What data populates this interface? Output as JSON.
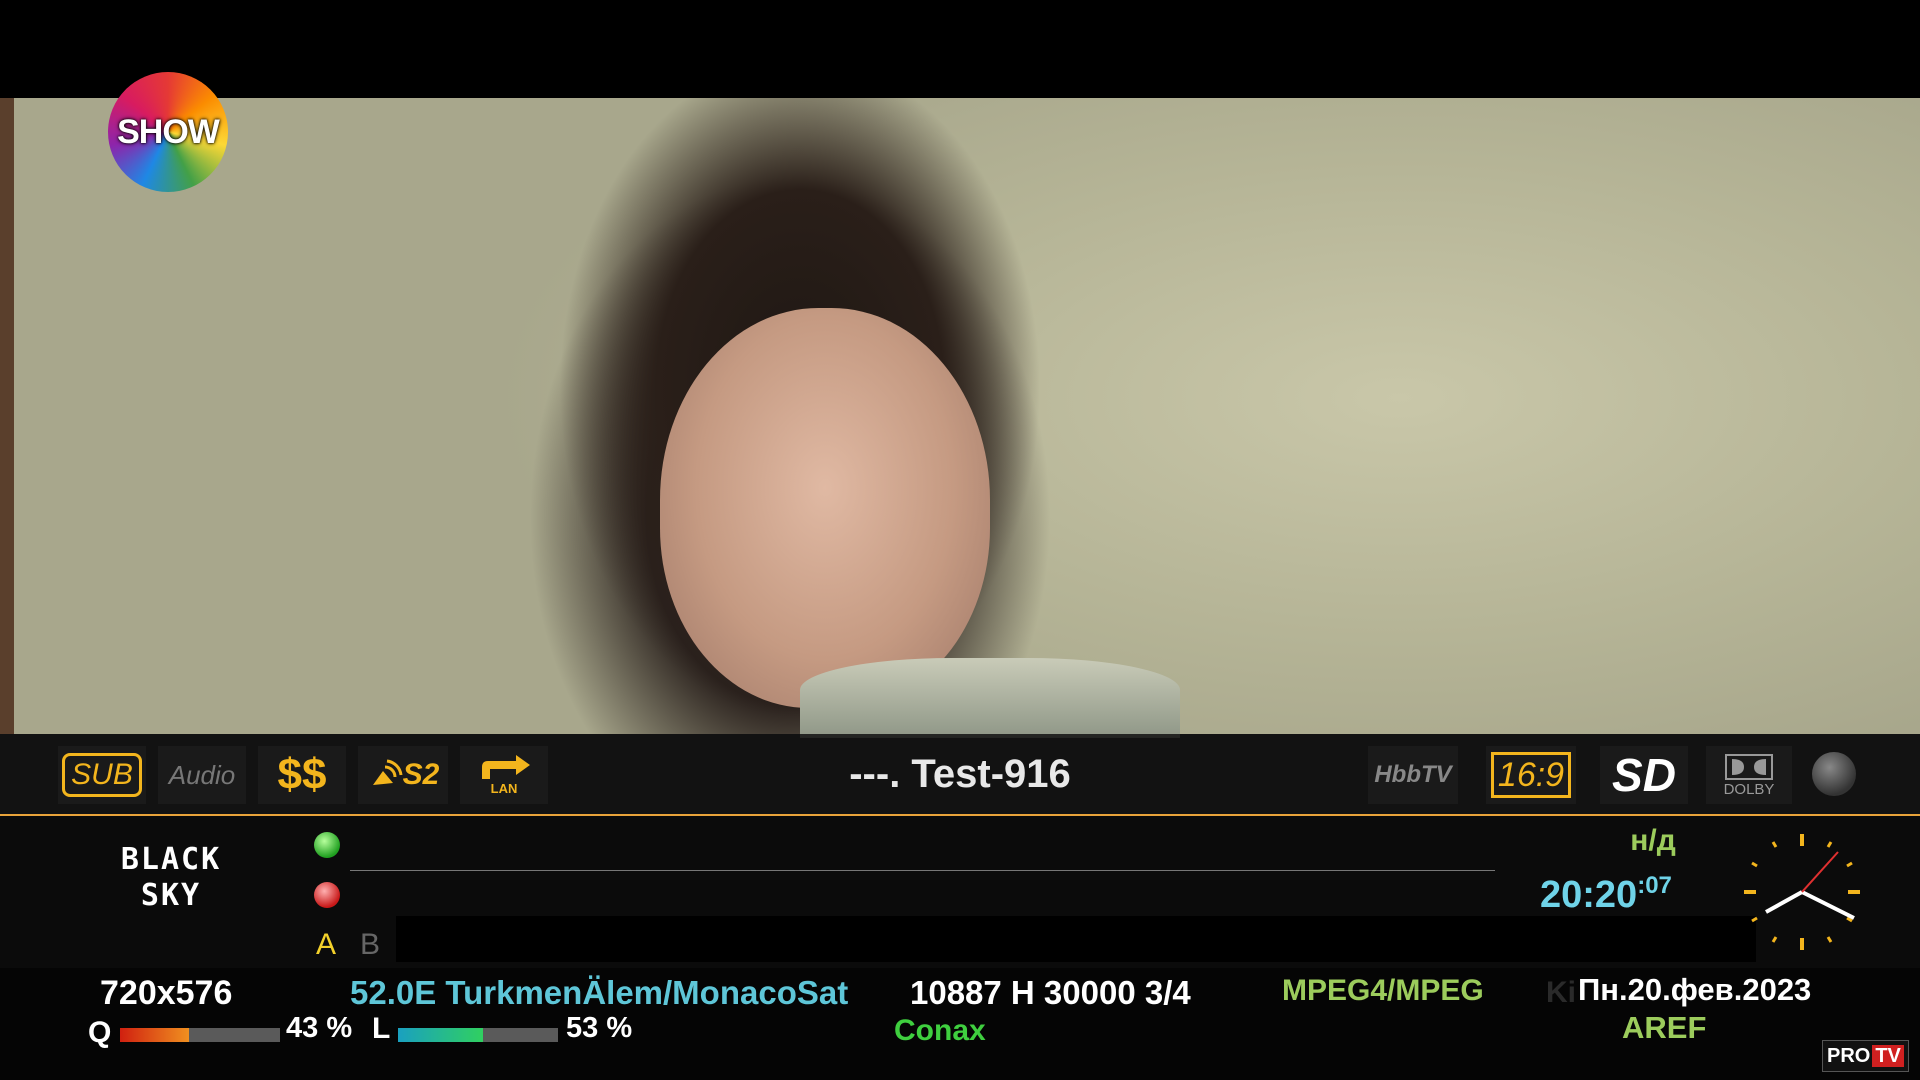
{
  "channel_logo": {
    "text": "SHOW"
  },
  "info_bar": {
    "badges": {
      "sub": "SUB",
      "audio": "Audio",
      "cas": "$$",
      "s2": "S2",
      "lan": "LAN",
      "hbbtv": "HbbTV",
      "aspect": "16:9",
      "definition": "SD",
      "dolby": "DOLBY"
    },
    "channel_title": "---. Test-916"
  },
  "epg": {
    "brand_line1": "BLACK",
    "brand_line2": "SKY",
    "slot_a": "A",
    "slot_b": "B",
    "day": "н/д",
    "time_main": "20:20",
    "time_seconds": ":07"
  },
  "status": {
    "resolution": "720x576",
    "satellite": "52.0E TurkmenÄlem/MonacoSat",
    "transponder": "10887 H 30000 3/4",
    "codec": "MPEG4/MPEG",
    "date": "Пн.20.фев.2023",
    "ki": "Ki",
    "cas_system": "Conax",
    "aref": "AREF",
    "quality_label": "Q",
    "quality_value": 43,
    "quality_text": "43 %",
    "level_label": "L",
    "level_value": 53,
    "level_text": "53 %"
  },
  "watermark": {
    "pro": "PRO",
    "tv": "TV"
  },
  "colors": {
    "accent": "#e8a33a",
    "badge_yellow": "#f3b51d",
    "time": "#6fd3e8",
    "green_text": "#9ccc5c"
  }
}
